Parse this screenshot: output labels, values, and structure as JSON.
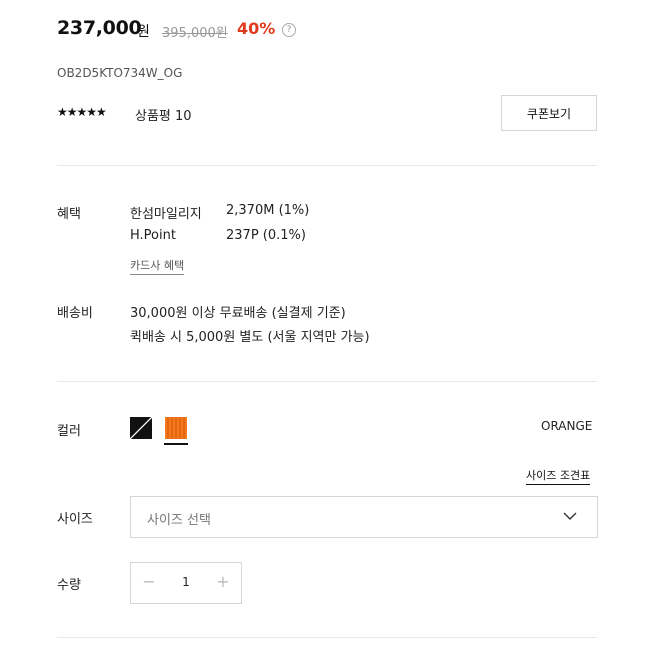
{
  "price": {
    "current": "237,000",
    "currency_unit": "원",
    "original": "395,000원",
    "discount": "40%",
    "help_symbol": "?"
  },
  "product_code": "OB2D5KTO734W_OG",
  "rating": {
    "stars": "★★★★★",
    "review_label": "상품평 10"
  },
  "coupon_button": "쿠폰보기",
  "benefit": {
    "label": "혜택",
    "items": [
      {
        "name": "한섬마일리지",
        "value": "2,370M (1%)"
      },
      {
        "name": "H.Point",
        "value": "237P (0.1%)"
      }
    ],
    "card_link": "카드사 혜택"
  },
  "shipping": {
    "label": "배송비",
    "line1": "30,000원 이상 무료배송 (실결제 기준)",
    "line2": "퀵배송 시 5,000원 별도 (서울 지역만 가능)"
  },
  "color": {
    "label": "컬러",
    "selected": "ORANGE",
    "swatches": [
      "#111111",
      "#f17a1e"
    ]
  },
  "size_guide": "사이즈 조견표",
  "size": {
    "label": "사이즈",
    "placeholder": "사이즈 선택"
  },
  "quantity": {
    "label": "수량",
    "value": "1",
    "minus": "−",
    "plus": "+"
  }
}
